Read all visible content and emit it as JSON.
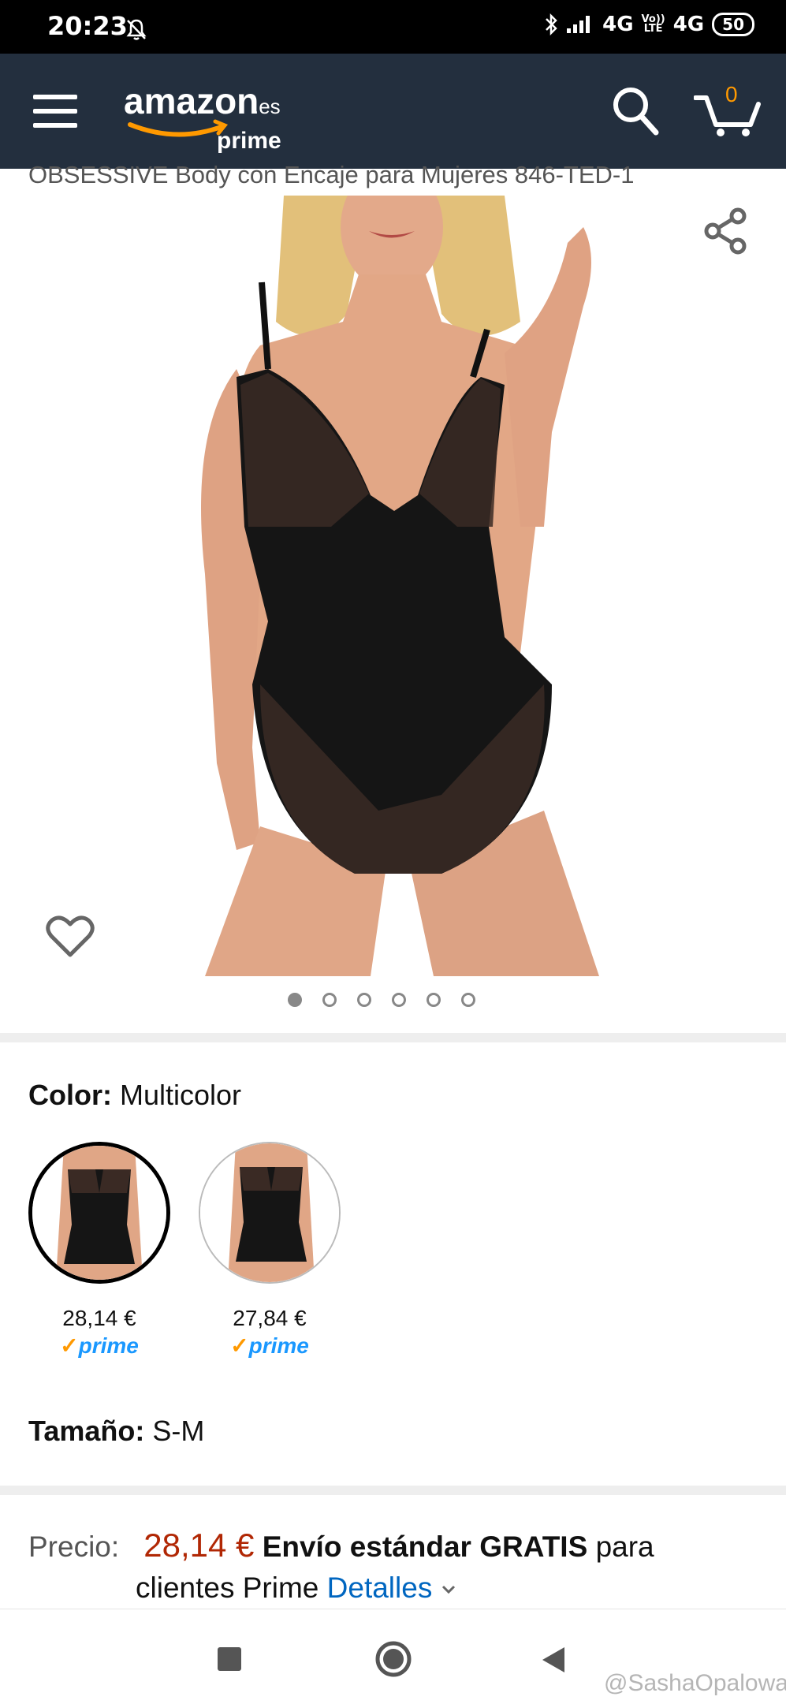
{
  "status_bar": {
    "time": "20:23",
    "network_1": "4G",
    "volte_top": "Vo))",
    "volte_bottom": "LTE",
    "network_2": "4G",
    "battery": "50"
  },
  "header": {
    "logo_text": "amazon",
    "logo_suffix": ".es",
    "logo_sub": "prime",
    "cart_count": "0"
  },
  "product": {
    "title": "OBSESSIVE Body con Encaje para Mujeres 846-TED-1",
    "image_count": 6,
    "active_image": 1
  },
  "color": {
    "label": "Color:",
    "value": "Multicolor",
    "options": [
      {
        "price": "28,14 €",
        "prime": "prime",
        "selected": true
      },
      {
        "price": "27,84 €",
        "prime": "prime",
        "selected": false
      }
    ]
  },
  "size": {
    "label": "Tamaño:",
    "value": "S-M"
  },
  "pricing": {
    "label": "Precio:",
    "price": "28,14 €",
    "shipping_bold": "Envío estándar GRATIS",
    "shipping_rest_1": "para",
    "shipping_rest_2": "clientes Prime",
    "details_link": "Detalles"
  },
  "watermark": "@SashaOpalowa",
  "colors": {
    "header_bg": "#232f3e",
    "amazon_orange": "#ff9900",
    "price_red": "#b12704",
    "link_blue": "#0066c0",
    "prime_blue": "#1a98ff"
  }
}
